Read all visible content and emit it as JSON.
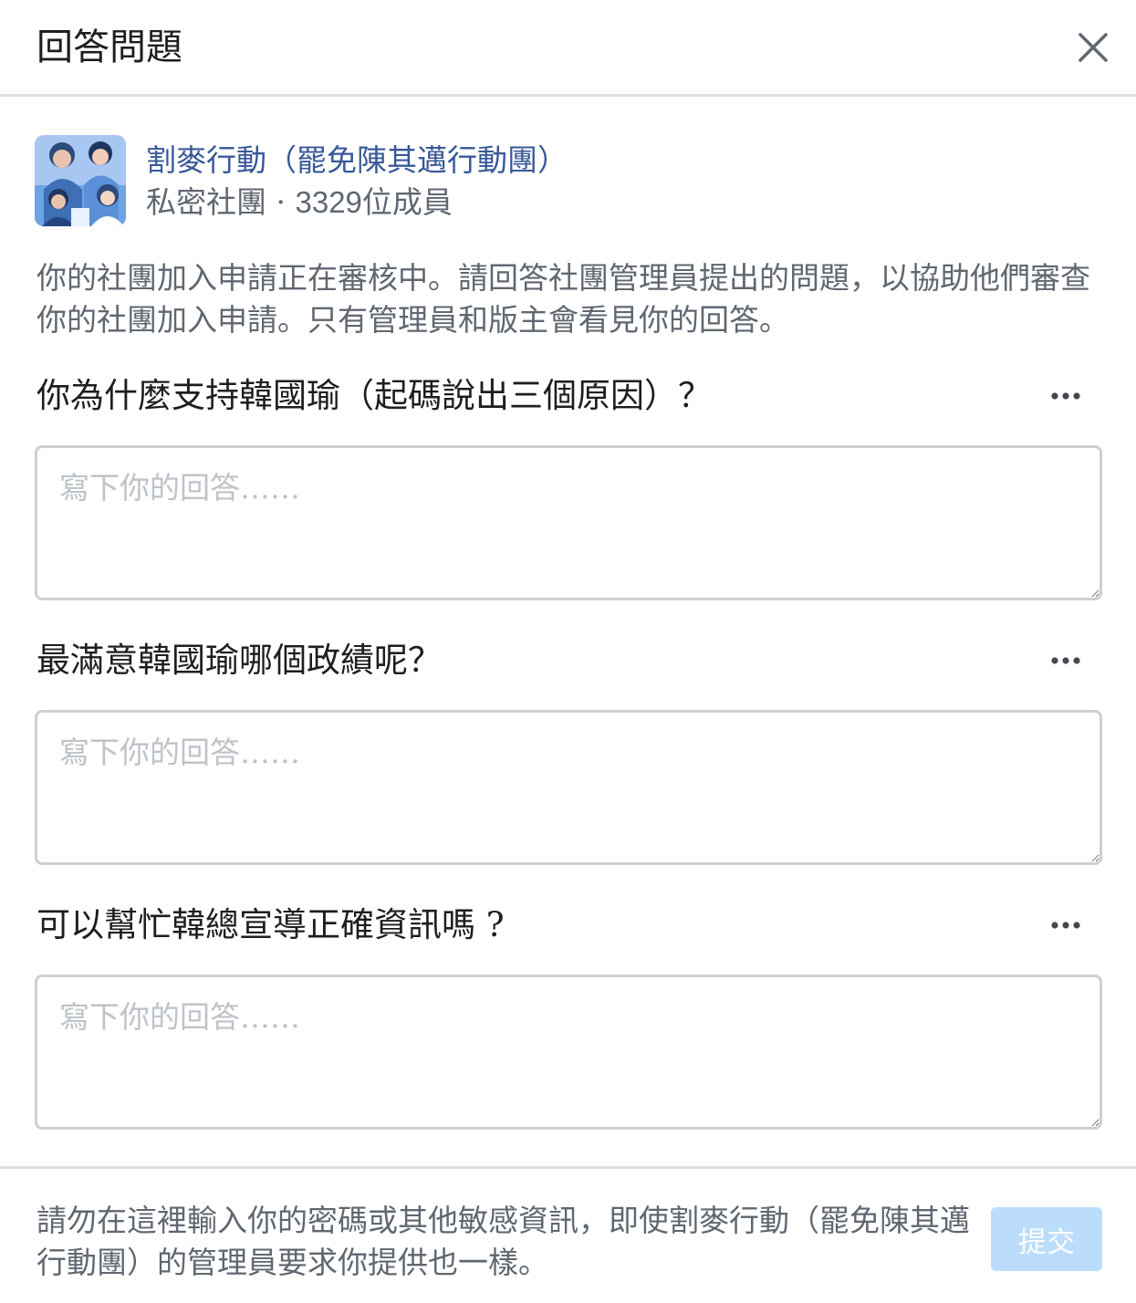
{
  "dialog": {
    "title": "回答問題"
  },
  "group": {
    "name": "割麥行動（罷免陳其邁行動團）",
    "privacy": "私密社團 · ",
    "member_count": "3329",
    "member_suffix": "位成員"
  },
  "intro": "你的社團加入申請正在審核中。請回答社團管理員提出的問題，以協助他們審查你的社團加入申請。只有管理員和版主會看見你的回答。",
  "questions": [
    {
      "text": "你為什麼支持韓國瑜（起碼說出三個原因）？",
      "placeholder": "寫下你的回答……"
    },
    {
      "text": "最滿意韓國瑜哪個政績呢？",
      "placeholder": "寫下你的回答……"
    },
    {
      "text": "可以幫忙韓總宣導正確資訊嗎 ?",
      "placeholder": "寫下你的回答……"
    }
  ],
  "footer": {
    "note": "請勿在這裡輸入你的密碼或其他敏感資訊，即使割麥行動（罷免陳其邁行動團）的管理員要求你提供也一樣。",
    "submit_label": "提交"
  },
  "colors": {
    "link": "#385898",
    "secondary_text": "#606770",
    "submit_disabled": "#bcdcfb",
    "border": "#ccd0d5"
  },
  "icons": {
    "close": "close-icon",
    "more": "more-horizontal-icon",
    "avatar": "group-avatar-illustration"
  }
}
